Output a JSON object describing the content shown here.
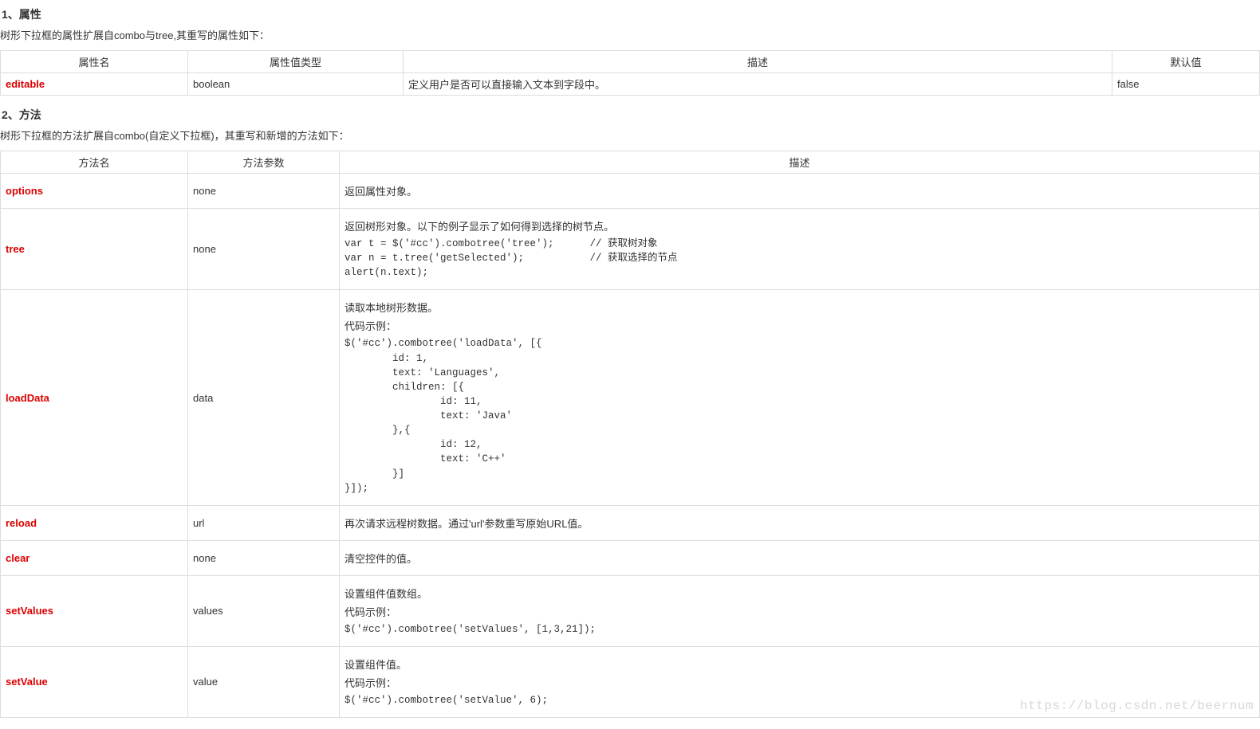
{
  "sections": {
    "attributes": {
      "heading": "1、属性",
      "intro": "树形下拉框的属性扩展自combo与tree,其重写的属性如下：",
      "headers": {
        "name": "属性名",
        "type": "属性值类型",
        "desc": "描述",
        "default": "默认值"
      },
      "rows": [
        {
          "name": "editable",
          "type": "boolean",
          "desc": "定义用户是否可以直接输入文本到字段中。",
          "default": "false"
        }
      ]
    },
    "methods": {
      "heading": "2、方法",
      "intro": "树形下拉框的方法扩展自combo(自定义下拉框)，其重写和新增的方法如下：",
      "headers": {
        "name": "方法名",
        "param": "方法参数",
        "desc": "描述"
      },
      "rows": [
        {
          "name": "options",
          "param": "none",
          "desc_parts": [
            {
              "type": "text",
              "value": "返回属性对象。"
            }
          ]
        },
        {
          "name": "tree",
          "param": "none",
          "desc_parts": [
            {
              "type": "text",
              "value": "返回树形对象。以下的例子显示了如何得到选择的树节点。"
            },
            {
              "type": "code",
              "value": "var t = $('#cc').combotree('tree');      // 获取树对象\nvar n = t.tree('getSelected');           // 获取选择的节点\nalert(n.text);"
            }
          ]
        },
        {
          "name": "loadData",
          "param": "data",
          "desc_parts": [
            {
              "type": "text",
              "value": "读取本地树形数据。"
            },
            {
              "type": "text",
              "value": "代码示例："
            },
            {
              "type": "code",
              "value": "$('#cc').combotree('loadData', [{\n        id: 1,\n        text: 'Languages',\n        children: [{\n                id: 11,\n                text: 'Java'\n        },{\n                id: 12,\n                text: 'C++'\n        }]\n}]);"
            }
          ]
        },
        {
          "name": "reload",
          "param": "url",
          "desc_parts": [
            {
              "type": "text",
              "value": "再次请求远程树数据。通过'url'参数重写原始URL值。"
            }
          ]
        },
        {
          "name": "clear",
          "param": "none",
          "desc_parts": [
            {
              "type": "text",
              "value": "清空控件的值。"
            }
          ]
        },
        {
          "name": "setValues",
          "param": "values",
          "desc_parts": [
            {
              "type": "text",
              "value": "设置组件值数组。"
            },
            {
              "type": "text",
              "value": "代码示例："
            },
            {
              "type": "code",
              "value": "$('#cc').combotree('setValues', [1,3,21]);"
            }
          ]
        },
        {
          "name": "setValue",
          "param": "value",
          "desc_parts": [
            {
              "type": "text",
              "value": "设置组件值。"
            },
            {
              "type": "text",
              "value": "代码示例："
            },
            {
              "type": "code",
              "value": "$('#cc').combotree('setValue', 6);"
            }
          ]
        }
      ]
    }
  },
  "watermark": "https://blog.csdn.net/beernum"
}
